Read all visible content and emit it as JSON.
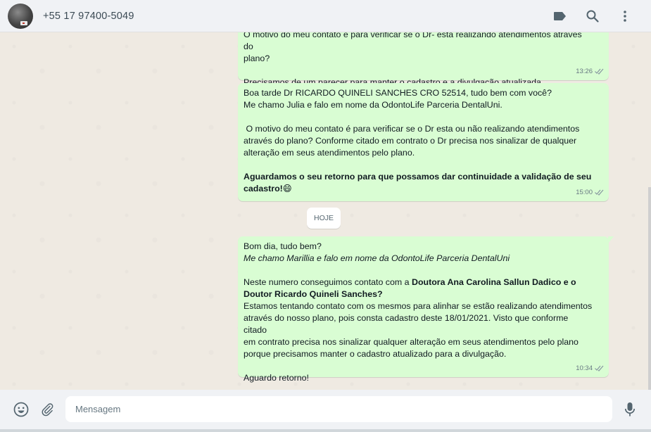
{
  "header": {
    "contact_name": "+55 17 97400-5049",
    "icons": [
      "label-icon",
      "search-icon",
      "menu-icon"
    ]
  },
  "chat": {
    "date_chip": "HOJE",
    "messages": [
      {
        "lines": [
          "O motivo do meu contato é para verificar se o Dr- está realizando atendimentos através do",
          "plano?",
          "",
          "Precisamos de um parecer para manter o cadastro e a divulgação atualizada."
        ],
        "time": "13:26"
      },
      {
        "lines": [
          "Boa tarde Dr RICARDO QUINELI SANCHES CRO 52514, tudo bem com você?",
          "Me chamo Julia e falo em nome da OdontoLife Parceria DentalUni.",
          "",
          " O motivo do meu contato é para verificar se o Dr esta ou não realizando atendimentos",
          "através do plano? Conforme citado em contrato o Dr precisa nos sinalizar de qualquer",
          "alteração em seus atendimentos pelo plano."
        ],
        "bold_lines": [
          "Aguardamos o seu retorno para que possamos dar continuidade a validação de seu",
          "cadastro!"
        ],
        "emoji": "😄",
        "time": "15:00"
      },
      {
        "line1": "Bom dia, tudo bem?",
        "line2_italic": "Me chamo Marillia e falo em nome da OdontoLife Parceria DentalUni",
        "line3_prefix": "Neste numero conseguimos contato com a ",
        "line3_bold": "Doutora Ana Carolina Sallun Dadico e o",
        "line4_bold": "Doutor Ricardo Quineli Sanches?",
        "body_lines": [
          "Estamos tentando contato com os mesmos para alinhar se estão realizando atendimentos",
          "através do nosso plano, pois consta cadastro deste 18/01/2021. Visto que conforme citado",
          "em contrato precisa nos sinalizar qualquer alteração em seus atendimentos pelo plano",
          "porque precisamos manter o cadastro atualizado para a divulgação."
        ],
        "closing": "Aguardo retorno!",
        "time": "10:34"
      }
    ]
  },
  "footer": {
    "placeholder": "Mensagem",
    "icons": [
      "emoji-icon",
      "attach-icon",
      "microphone-icon"
    ]
  },
  "colors": {
    "bubble_out": "#d9fdd3",
    "chat_bg": "#efeae2",
    "panel_bg": "#f0f2f5",
    "icon": "#54656f"
  }
}
